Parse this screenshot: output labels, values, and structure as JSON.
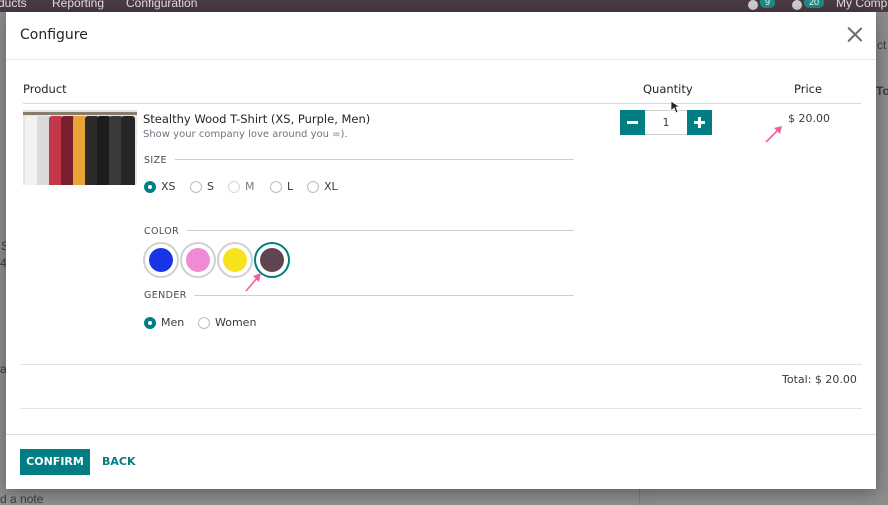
{
  "background": {
    "menu": [
      "ducts",
      "Reporting",
      "Configuration"
    ],
    "badges": [
      "9",
      "20"
    ],
    "company": "My Comp",
    "right_edge_texts": [
      "ct",
      "Too"
    ],
    "left_edge_texts": [
      "S",
      "4",
      "a"
    ],
    "note_link": "d a note"
  },
  "modal": {
    "title": "Configure",
    "columns": {
      "product": "Product",
      "quantity": "Quantity",
      "price": "Price"
    },
    "product": {
      "name": "Stealthy Wood T-Shirt (XS, Purple, Men)",
      "description": "Show your company love around you =)."
    },
    "attributes": {
      "size": {
        "label": "SIZE",
        "options": [
          {
            "label": "XS",
            "selected": true,
            "available": true
          },
          {
            "label": "S",
            "selected": false,
            "available": true
          },
          {
            "label": "M",
            "selected": false,
            "available": false
          },
          {
            "label": "L",
            "selected": false,
            "available": true
          },
          {
            "label": "XL",
            "selected": false,
            "available": true
          }
        ]
      },
      "color": {
        "label": "COLOR",
        "options": [
          {
            "name": "Blue",
            "hex": "#1a35e6",
            "selected": false
          },
          {
            "name": "Pink",
            "hex": "#f08ad6",
            "selected": false
          },
          {
            "name": "Yellow",
            "hex": "#f7e31b",
            "selected": false
          },
          {
            "name": "Purple",
            "hex": "#5e4550",
            "selected": true
          }
        ]
      },
      "gender": {
        "label": "GENDER",
        "options": [
          {
            "label": "Men",
            "selected": true
          },
          {
            "label": "Women",
            "selected": false
          }
        ]
      }
    },
    "quantity": "1",
    "price": "$ 20.00",
    "total": "Total: $ 20.00",
    "buttons": {
      "confirm": "CONFIRM",
      "back": "BACK"
    }
  },
  "colors": {
    "accent": "#017e84",
    "annotation_arrow": "#f0609e"
  }
}
